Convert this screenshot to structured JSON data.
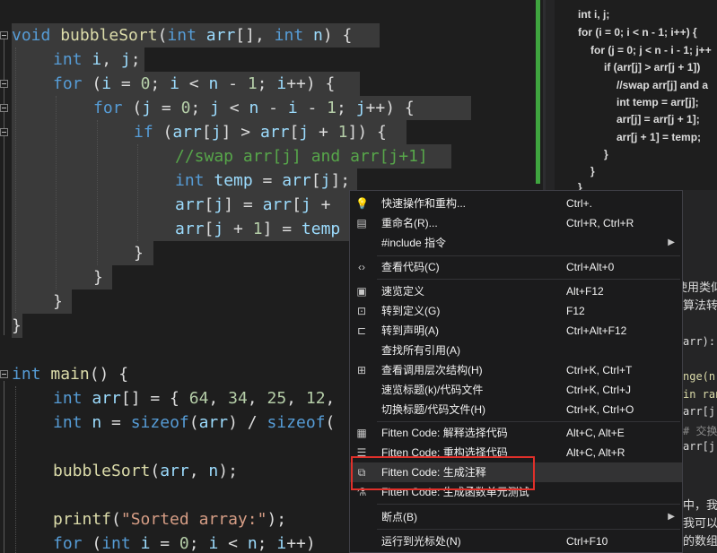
{
  "code": {
    "l1": {
      "kw": "void",
      "fn": "bubbleSort",
      "p1": "(",
      "kw2": "int",
      "v1": "arr",
      "p2": "[], ",
      "kw3": "int",
      "v2": "n",
      "p3": ") {"
    },
    "l2": {
      "kw": "int",
      "v": "i",
      "p1": ", ",
      "v2": "j",
      "p2": ";"
    },
    "l3": {
      "kw": "for",
      "p1": " (",
      "v1": "i",
      "p2": " = ",
      "n1": "0",
      "p3": "; ",
      "v2": "i",
      "p4": " < ",
      "v3": "n",
      "p5": " - ",
      "n2": "1",
      "p6": "; ",
      "v4": "i",
      "p7": "++) {"
    },
    "l4": {
      "kw": "for",
      "p1": " (",
      "v1": "j",
      "p2": " = ",
      "n1": "0",
      "p3": "; ",
      "v2": "j",
      "p4": " < ",
      "v3": "n",
      "p5": " - ",
      "v4": "i",
      "p6": " - ",
      "n2": "1",
      "p7": "; ",
      "v5": "j",
      "p8": "++) {"
    },
    "l5": {
      "kw": "if",
      "p1": " (",
      "v1": "arr",
      "p2": "[",
      "v2": "j",
      "p3": "] > ",
      "v3": "arr",
      "p4": "[",
      "v5": "j",
      "p5": " + ",
      "n1": "1",
      "p6": "]) {"
    },
    "l6": {
      "cm": "//swap arr[j] and arr[j+1]"
    },
    "l7": {
      "kw": "int",
      "v1": "temp",
      "p1": " = ",
      "v2": "arr",
      "p2": "[",
      "v3": "j",
      "p3": "];"
    },
    "l8": {
      "v1": "arr",
      "p1": "[",
      "v2": "j",
      "p2": "] = ",
      "v3": "arr",
      "p3": "[",
      "v4": "j",
      "p4": " +"
    },
    "l9": {
      "v1": "arr",
      "p1": "[",
      "v2": "j",
      "p2": " + ",
      "n1": "1",
      "p3": "] = ",
      "v3": "temp"
    },
    "brace": "}",
    "m1": {
      "kw": "int",
      "fn": "main",
      "p1": "() {"
    },
    "m2": {
      "kw": "int",
      "v1": "arr",
      "p1": "[] = { ",
      "n1": "64",
      "p2": ", ",
      "n2": "34",
      "p3": ", ",
      "n3": "25",
      "p4": ", ",
      "n4": "12",
      "p5": ","
    },
    "m3": {
      "kw": "int",
      "v1": "n",
      "p1": " = ",
      "kw2": "sizeof",
      "p2": "(",
      "v2": "arr",
      "p3": ") / ",
      "kw3": "sizeof",
      "p4": "("
    },
    "m4": {
      "fn": "bubbleSort",
      "p1": "(",
      "v1": "arr",
      "p2": ", ",
      "v2": "n",
      "p3": ");"
    },
    "m5": {
      "fn": "printf",
      "p1": "(",
      "st": "\"Sorted array:\"",
      "p2": ");"
    },
    "m6": {
      "kw": "for",
      "p1": " (",
      "kw2": "int",
      "v1": "i",
      "p2": " = ",
      "n1": "0",
      "p3": "; ",
      "v2": "i",
      "p4": " < ",
      "v3": "n",
      "p5": "; ",
      "v4": "i",
      "p6": "++)"
    }
  },
  "snippet": [
    "int i, j;",
    "for (i = 0; i < n - 1; i++) {",
    "for (j = 0; j < n - i - 1; j++",
    "if (arr[j] > arr[j + 1])",
    "//swap arr[j] and a",
    "int temp = arr[j];",
    "arr[j] = arr[j + 1];",
    "arr[j + 1] = temp;",
    "}",
    "}",
    "}"
  ],
  "right_text": {
    "t1": "使用类似",
    "t2": "算法转",
    "c1": "arr):",
    "c2": "nge(n-",
    "c3": "in rang",
    "c4": "arr[j]",
    "c5": "# 交换",
    "c6": "arr[j",
    "t3": "中，我们",
    "t4": "我可以将",
    "t5": "的数组长"
  },
  "menu": {
    "items": [
      {
        "label": "快速操作和重构...",
        "shortcut": "Ctrl+.",
        "icon": "lightbulb-icon"
      },
      {
        "label": "重命名(R)...",
        "shortcut": "Ctrl+R, Ctrl+R",
        "icon": "rename-icon"
      },
      {
        "label": "#include 指令",
        "shortcut": "",
        "icon": "",
        "submenu": true
      },
      {
        "label": "查看代码(C)",
        "shortcut": "Ctrl+Alt+0",
        "icon": "code-icon"
      },
      {
        "label": "速览定义",
        "shortcut": "Alt+F12",
        "icon": "peek-icon"
      },
      {
        "label": "转到定义(G)",
        "shortcut": "F12",
        "icon": "goto-definition-icon"
      },
      {
        "label": "转到声明(A)",
        "shortcut": "Ctrl+Alt+F12",
        "icon": "goto-declaration-icon"
      },
      {
        "label": "查找所有引用(A)",
        "shortcut": "",
        "icon": ""
      },
      {
        "label": "查看调用层次结构(H)",
        "shortcut": "Ctrl+K, Ctrl+T",
        "icon": "call-hierarchy-icon"
      },
      {
        "label": "速览标题(k)/代码文件",
        "shortcut": "Ctrl+K, Ctrl+J",
        "icon": ""
      },
      {
        "label": "切换标题/代码文件(H)",
        "shortcut": "Ctrl+K, Ctrl+O",
        "icon": ""
      },
      {
        "label": "Fitten Code: 解释选择代码",
        "shortcut": "Alt+C, Alt+E",
        "icon": "fitten-explain-icon"
      },
      {
        "label": "Fitten Code: 重构选择代码",
        "shortcut": "Alt+C, Alt+R",
        "icon": "fitten-refactor-icon"
      },
      {
        "label": "Fitten Code: 生成注释",
        "shortcut": "",
        "icon": "fitten-comment-icon"
      },
      {
        "label": "Fitten Code: 生成函数单元测试",
        "shortcut": "",
        "icon": "fitten-test-icon"
      },
      {
        "label": "断点(B)",
        "shortcut": "",
        "icon": "",
        "submenu": true
      },
      {
        "label": "运行到光标处(N)",
        "shortcut": "Ctrl+F10",
        "icon": "run-to-cursor-icon"
      }
    ]
  }
}
